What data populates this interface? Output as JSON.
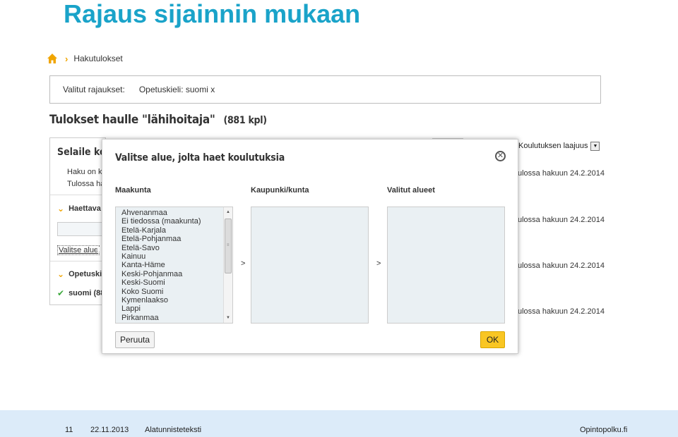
{
  "slide": {
    "title": "Rajaus sijainnin mukaan"
  },
  "breadcrumb": {
    "home_icon": "home-icon",
    "current": "Hakutulokset"
  },
  "filters": {
    "label": "Valitut rajaukset:",
    "chip": "Opetuskieli: suomi x"
  },
  "results": {
    "heading": "Tulokset haulle \"lähihoitaja\"",
    "count": "(881 kpl)",
    "dates": [
      "ulossa hakuun 24.2.2014",
      "ulossa hakuun 24.2.2014",
      "ulossa hakuun 24.2.2014",
      "ulossa hakuun 24.2.2014"
    ]
  },
  "sort": {
    "selected": "Koulutuksen laajuus"
  },
  "left_panel": {
    "title": "Selaile koul",
    "text1": "Haku on k",
    "text2": "Tulossa ha",
    "section1": "Haettava",
    "location_link": "Valitse alue",
    "section2": "Opetuski",
    "language_option": "suomi (88"
  },
  "modal": {
    "title": "Valitse alue, jolta haet koulutuksia",
    "col_region": "Maakunta",
    "col_city": "Kaupunki/kunta",
    "col_selected": "Valitut alueet",
    "regions": [
      "Ahvenanmaa",
      "Ei tiedossa (maakunta)",
      "Etelä-Karjala",
      "Etelä-Pohjanmaa",
      "Etelä-Savo",
      "Kainuu",
      "Kanta-Häme",
      "Keski-Pohjanmaa",
      "Keski-Suomi",
      "Koko Suomi",
      "Kymenlaakso",
      "Lappi",
      "Pirkanmaa"
    ],
    "move_arrow": ">",
    "cancel": "Peruuta",
    "ok": "OK"
  },
  "footer": {
    "page_number": "11",
    "date": "22.11.2013",
    "text": "Alatunnisteteksti",
    "brand": "Opintopolku.fi"
  },
  "colors": {
    "title": "#1aa3c9",
    "accent": "#f0a500",
    "ok_button": "#f9c623",
    "footer_bg": "#dcebf9"
  }
}
